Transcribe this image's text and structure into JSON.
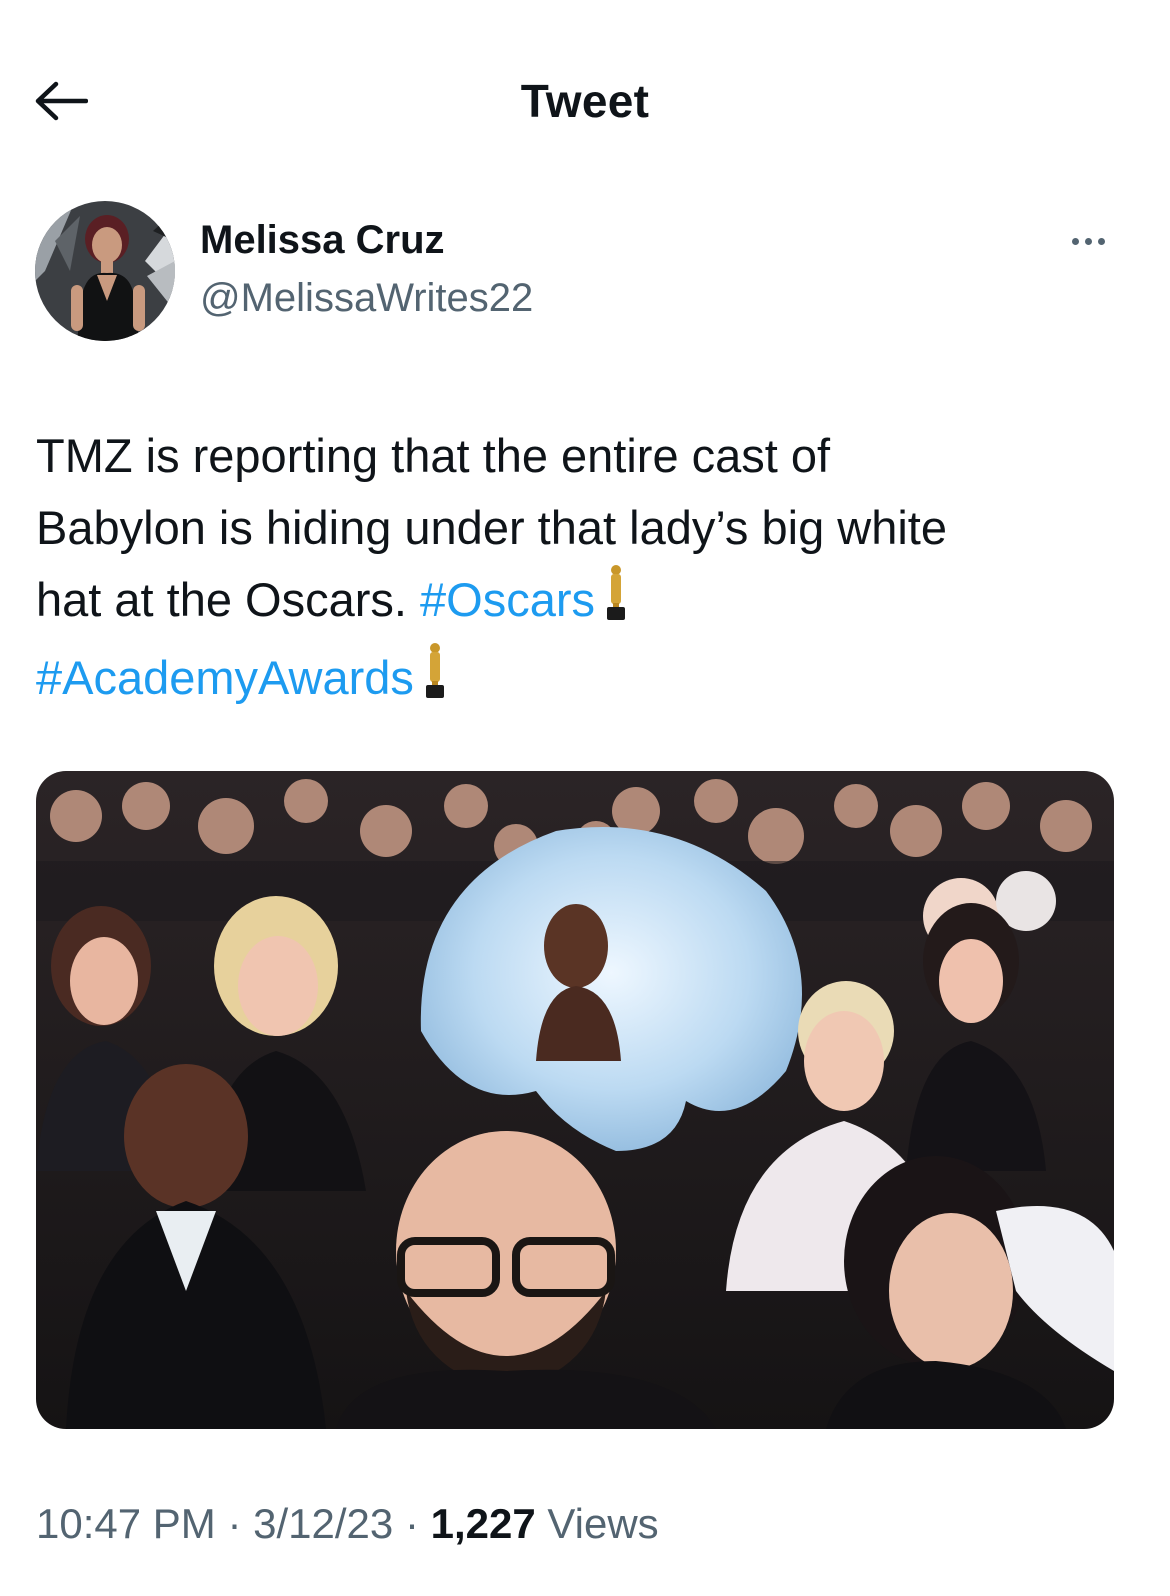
{
  "header": {
    "title": "Tweet"
  },
  "author": {
    "name": "Melissa Cruz",
    "handle": "@MelissaWrites22"
  },
  "tweet": {
    "text_line_1": "TMZ is reporting that the entire cast of",
    "text_line_2": "Babylon is hiding under that lady’s big white",
    "text_line_3": "hat at the Oscars.",
    "hashtag_1": "#Oscars",
    "hashtag_2": "#AcademyAwards"
  },
  "meta": {
    "time": "10:47 PM",
    "separator": "·",
    "date": "3/12/23",
    "views_count": "1,227",
    "views_label": "Views"
  },
  "icons": {
    "back": "arrow-left-icon",
    "more": "more-dots-icon",
    "emoji": "oscar-trophy-emoji"
  },
  "colors": {
    "link": "#1d9bf0",
    "secondary": "#536471",
    "text": "#0f1419"
  }
}
